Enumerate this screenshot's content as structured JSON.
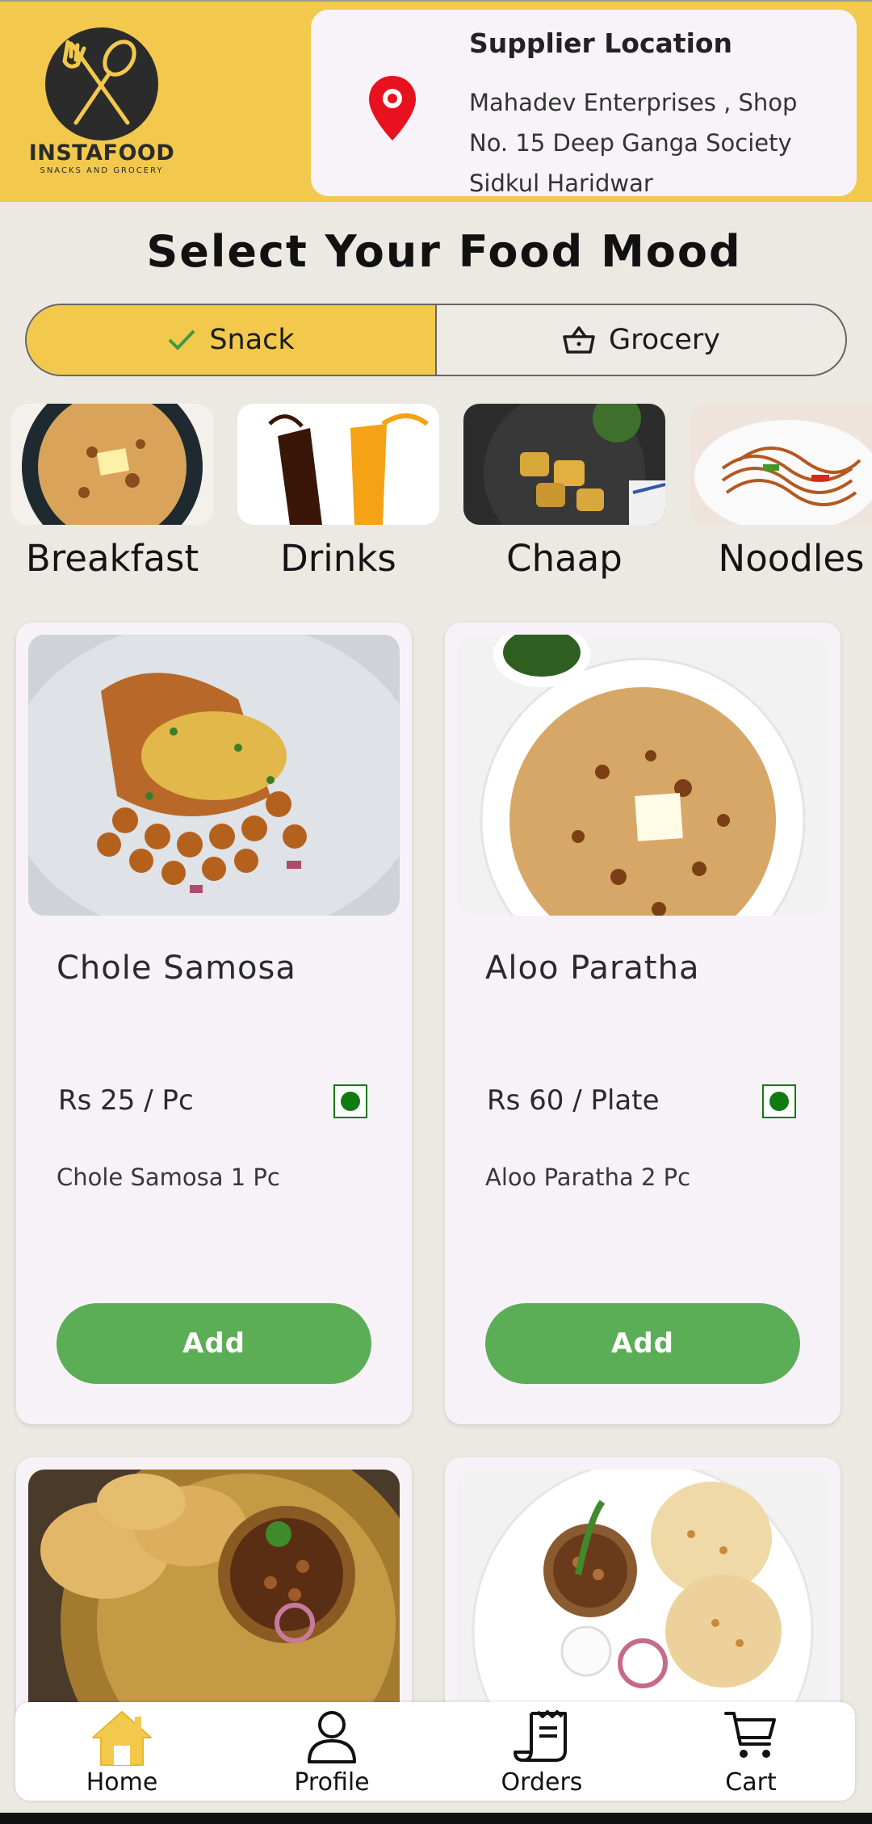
{
  "brand": {
    "name": "INSTAFOOD",
    "tagline": "SNACKS AND GROCERY"
  },
  "supplier": {
    "title": "Supplier Location",
    "address_lines": [
      "Mahadev Enterprises , Shop",
      "No. 15 Deep Ganga Society",
      "Sidkul Haridwar"
    ]
  },
  "mood": {
    "title": "Select Your Food Mood",
    "options": [
      {
        "label": "Snack",
        "icon": "check-icon",
        "selected": true
      },
      {
        "label": "Grocery",
        "icon": "basket-icon",
        "selected": false
      }
    ]
  },
  "categories": [
    {
      "label": "Breakfast"
    },
    {
      "label": "Drinks"
    },
    {
      "label": "Chaap"
    },
    {
      "label": "Noodles"
    }
  ],
  "products": [
    {
      "name": "Chole Samosa",
      "price": "Rs 25 / Pc",
      "description": "Chole Samosa 1 Pc",
      "add_label": "Add",
      "veg": true
    },
    {
      "name": "Aloo Paratha",
      "price": "Rs 60 / Plate",
      "description": "Aloo Paratha 2 Pc",
      "add_label": "Add",
      "veg": true
    },
    {
      "name": "",
      "price": "",
      "description": "",
      "add_label": "",
      "veg": true
    },
    {
      "name": "",
      "price": "",
      "description": "",
      "add_label": "",
      "veg": true
    }
  ],
  "nav": [
    {
      "label": "Home",
      "icon": "home-icon",
      "active": true
    },
    {
      "label": "Profile",
      "icon": "profile-icon",
      "active": false
    },
    {
      "label": "Orders",
      "icon": "orders-icon",
      "active": false
    },
    {
      "label": "Cart",
      "icon": "cart-icon",
      "active": false
    }
  ],
  "colors": {
    "accent": "#F2C94C",
    "add_button": "#5BAE55",
    "veg": "#127A12",
    "pin": "#E8111F"
  }
}
